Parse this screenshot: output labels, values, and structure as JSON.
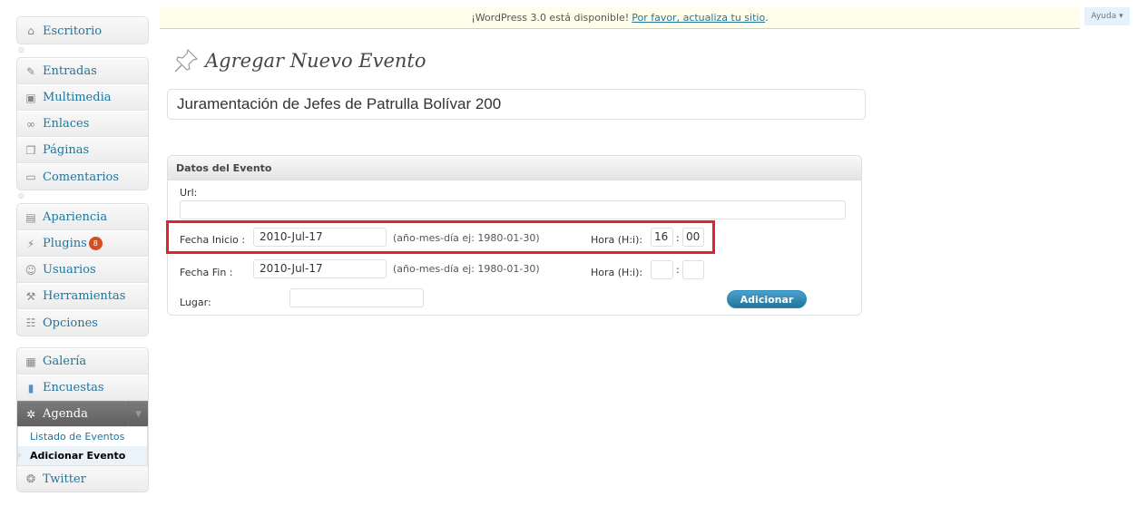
{
  "sidebar": {
    "group1": [
      {
        "label": "Escritorio",
        "icon": "home-icon"
      }
    ],
    "group2": [
      {
        "label": "Entradas",
        "icon": "pushpin-icon"
      },
      {
        "label": "Multimedia",
        "icon": "media-icon"
      },
      {
        "label": "Enlaces",
        "icon": "link-icon"
      },
      {
        "label": "Páginas",
        "icon": "pages-icon"
      },
      {
        "label": "Comentarios",
        "icon": "comment-icon"
      }
    ],
    "group3": [
      {
        "label": "Apariencia",
        "icon": "appearance-icon"
      },
      {
        "label": "Plugins",
        "icon": "plugin-icon",
        "badge": "8"
      },
      {
        "label": "Usuarios",
        "icon": "users-icon"
      },
      {
        "label": "Herramientas",
        "icon": "tools-icon"
      },
      {
        "label": "Opciones",
        "icon": "settings-icon"
      }
    ],
    "group4": [
      {
        "label": "Galería",
        "icon": "gallery-icon"
      },
      {
        "label": "Encuestas",
        "icon": "poll-icon"
      },
      {
        "label": "Agenda",
        "icon": "gear-icon"
      }
    ],
    "submenu": [
      {
        "label": "Listado de Eventos"
      },
      {
        "label": "Adicionar Evento"
      }
    ],
    "group5": [
      {
        "label": "Twitter",
        "icon": "twitter-icon"
      }
    ]
  },
  "update_nag": {
    "text": "¡WordPress 3.0 está disponible!",
    "link": "Por favor, actualiza tu sitio",
    "end": "."
  },
  "help": {
    "label": "Ayuda ▾"
  },
  "page": {
    "title": "Agregar Nuevo Evento",
    "title_value": "Juramentación de Jefes de Patrulla Bolívar 200"
  },
  "event_box": {
    "header": "Datos del Evento",
    "url_label": "Url:",
    "url_value": "",
    "start_label": "Fecha Inicio :",
    "start_value": "2010-Jul-17",
    "date_hint": "(año-mes-día ej: 1980-01-30)",
    "time_label": "Hora (H:i):",
    "start_hour": "16",
    "start_min": "00",
    "end_label": "Fecha Fin :",
    "end_value": "2010-Jul-17",
    "end_hour": "",
    "end_min": "",
    "place_label": "Lugar:",
    "place_value": "",
    "colon": ":",
    "button": "Adicionar"
  },
  "colors": {
    "link": "#21759b",
    "highlight": "#e0232d",
    "badge": "#d54e21",
    "nag_bg": "#fffeeb"
  }
}
